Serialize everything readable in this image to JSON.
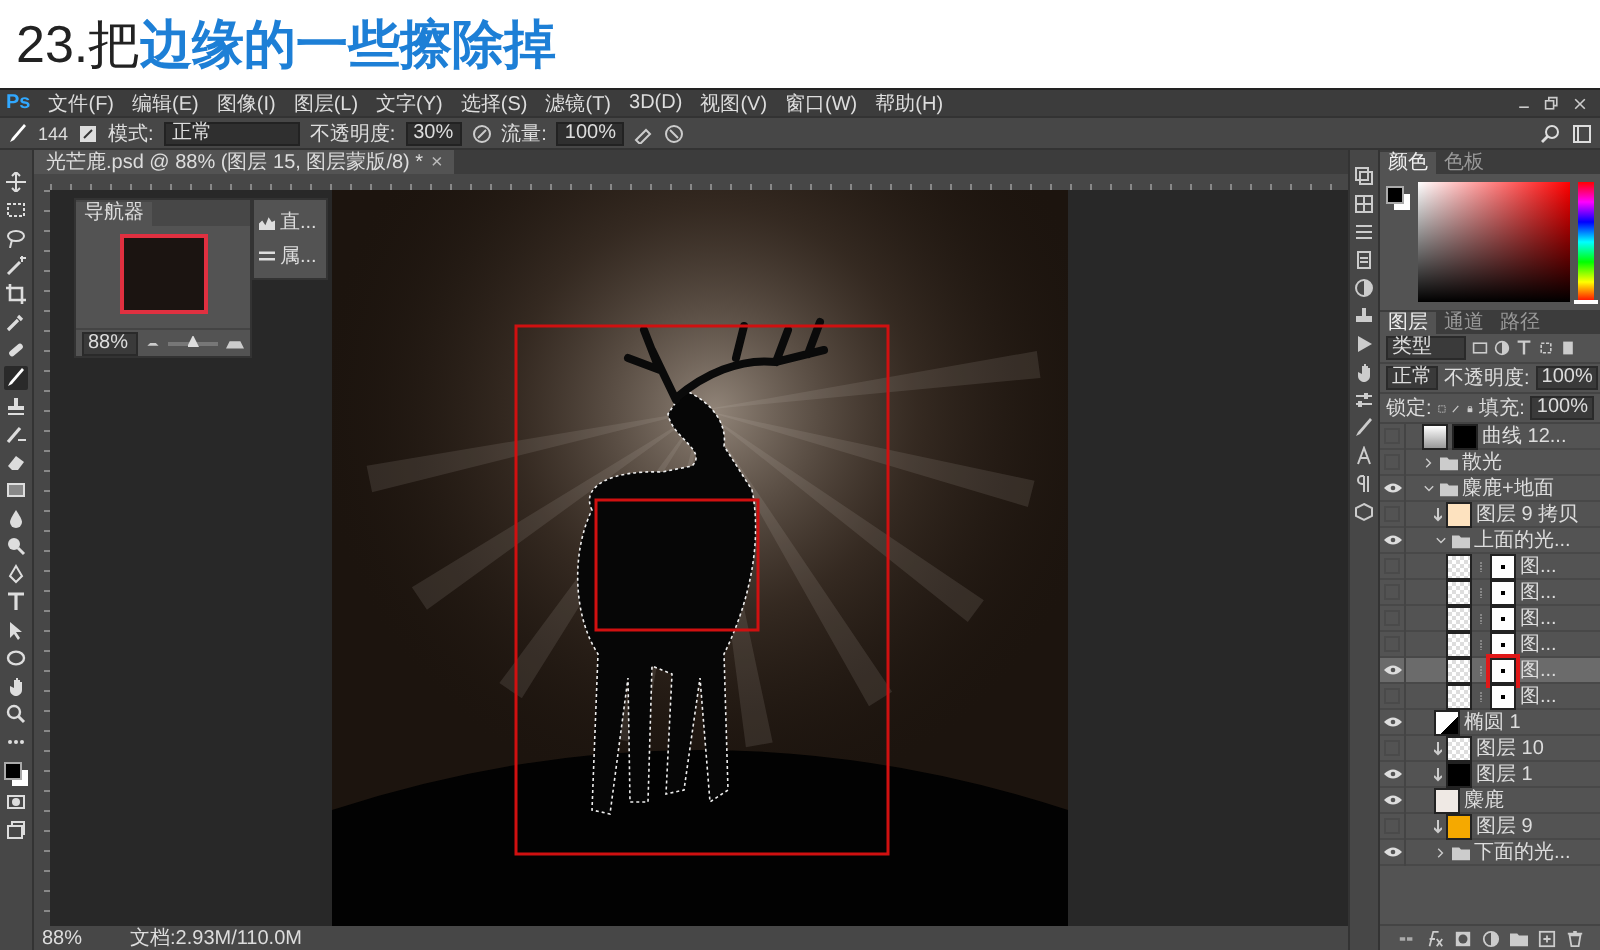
{
  "heading": {
    "number": "23.把",
    "highlight": "边缘的一些擦除掉"
  },
  "app_logo": "Ps",
  "menu": [
    "文件(F)",
    "编辑(E)",
    "图像(I)",
    "图层(L)",
    "文字(Y)",
    "选择(S)",
    "滤镜(T)",
    "3D(D)",
    "视图(V)",
    "窗口(W)",
    "帮助(H)"
  ],
  "options_bar": {
    "brush_size": "144",
    "mode_label": "模式:",
    "mode": "正常",
    "opacity_label": "不透明度:",
    "opacity": "30%",
    "flow_label": "流量:",
    "flow": "100%"
  },
  "document_tab": {
    "title": "光芒鹿.psd @ 88% (图层 15, 图层蒙版/8) *",
    "close": "×"
  },
  "tools": [
    {
      "kind": "move",
      "selected": false
    },
    {
      "kind": "marquee",
      "selected": false
    },
    {
      "kind": "lasso",
      "selected": false
    },
    {
      "kind": "wand",
      "selected": false
    },
    {
      "kind": "crop",
      "selected": false
    },
    {
      "kind": "eyedropper",
      "selected": false
    },
    {
      "kind": "healing",
      "selected": false
    },
    {
      "kind": "brush",
      "selected": true
    },
    {
      "kind": "stamp",
      "selected": false
    },
    {
      "kind": "history",
      "selected": false
    },
    {
      "kind": "eraser",
      "selected": false
    },
    {
      "kind": "gradient",
      "selected": false
    },
    {
      "kind": "blur",
      "selected": false
    },
    {
      "kind": "dodge",
      "selected": false
    },
    {
      "kind": "pen",
      "selected": false
    },
    {
      "kind": "type",
      "selected": false
    },
    {
      "kind": "path",
      "selected": false
    },
    {
      "kind": "ellipse",
      "selected": false
    },
    {
      "kind": "hand",
      "selected": false
    },
    {
      "kind": "zoom",
      "selected": false
    },
    {
      "kind": "more",
      "selected": false
    }
  ],
  "navigator": {
    "tab": "导航器",
    "zoom": "88%",
    "level": 0.5
  },
  "mini_panel": [
    {
      "kind": "histogram",
      "label": "直..."
    },
    {
      "kind": "properties",
      "label": "属..."
    }
  ],
  "color_panel": {
    "tabs": [
      {
        "label": "颜色",
        "selected": true
      },
      {
        "label": "色板",
        "selected": false
      }
    ],
    "hue": {
      "level": 0
    }
  },
  "layers_panel": {
    "tabs": [
      {
        "label": "图层",
        "selected": true
      },
      {
        "label": "通道",
        "selected": false
      },
      {
        "label": "路径",
        "selected": false
      }
    ],
    "filter": "类型",
    "blend_mode": "正常",
    "opacity_label": "不透明度:",
    "opacity": "100%",
    "lock_label": "锁定:",
    "fill_label": "填充:",
    "fill": "100%",
    "layers": [
      {
        "kind": "adjustment",
        "name": "曲线 12...",
        "visible": false,
        "selected": false,
        "clipped": false
      },
      {
        "kind": "group",
        "name": "散光",
        "visible": false,
        "selected": false,
        "expanded": false
      },
      {
        "kind": "group",
        "name": "麋鹿+地面",
        "visible": true,
        "selected": false,
        "expanded": true,
        "children": [
          {
            "kind": "layer",
            "name": "图层 9 拷贝",
            "visible": false,
            "selected": false,
            "clipped": true,
            "color": "#fde2bf"
          },
          {
            "kind": "group",
            "name": "上面的光...",
            "visible": true,
            "selected": false,
            "expanded": true,
            "children": [
              {
                "kind": "masked",
                "name": "图...",
                "visible": false,
                "selected": false,
                "clipped": false
              },
              {
                "kind": "masked",
                "name": "图...",
                "visible": false,
                "selected": false,
                "clipped": false
              },
              {
                "kind": "masked",
                "name": "图...",
                "visible": false,
                "selected": false,
                "clipped": false
              },
              {
                "kind": "masked",
                "name": "图...",
                "visible": false,
                "selected": false,
                "clipped": false
              },
              {
                "kind": "masked",
                "name": "图...",
                "visible": true,
                "selected": true,
                "clipped": false
              },
              {
                "kind": "masked",
                "name": "图...",
                "visible": false,
                "selected": false,
                "clipped": false
              }
            ]
          },
          {
            "kind": "shape",
            "name": "椭圆 1",
            "visible": true,
            "selected": false,
            "clipped": false
          },
          {
            "kind": "layer",
            "name": "图层 10",
            "visible": false,
            "selected": false,
            "clipped": true
          },
          {
            "kind": "layer",
            "name": "图层 1",
            "visible": true,
            "selected": false,
            "clipped": true,
            "color": "#000000"
          },
          {
            "kind": "layer",
            "name": "麋鹿",
            "visible": true,
            "selected": false,
            "clipped": false,
            "color": "#efe9e4"
          },
          {
            "kind": "layer",
            "name": "图层 9",
            "visible": false,
            "selected": false,
            "clipped": true,
            "color": "#f5a900"
          },
          {
            "kind": "group",
            "name": "下面的光...",
            "visible": true,
            "selected": false,
            "expanded": false
          }
        ]
      }
    ]
  },
  "status_bar": {
    "zoom": "88%",
    "doc_size": "文档:2.93M/110.0M"
  }
}
